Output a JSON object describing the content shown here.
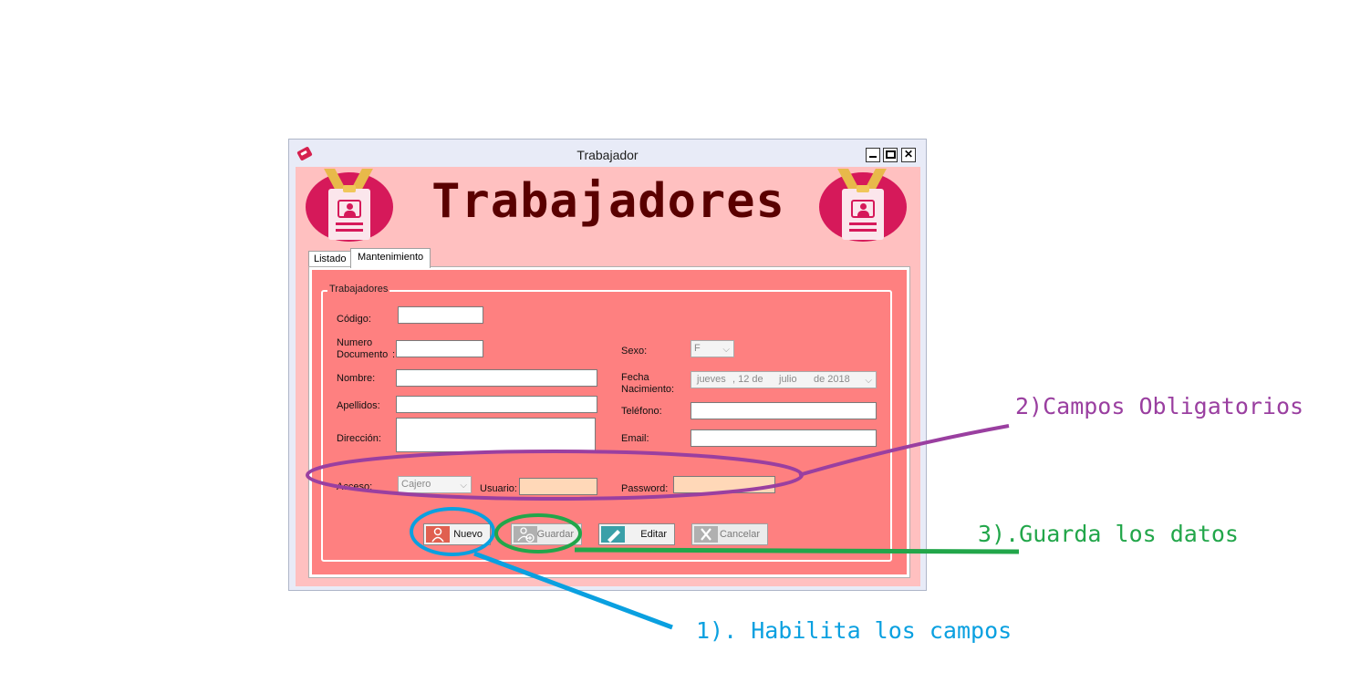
{
  "window": {
    "title": "Trabajador"
  },
  "header": {
    "brand": "Trabajadores"
  },
  "tabs": [
    {
      "label": "Listado"
    },
    {
      "label": "Mantenimiento"
    }
  ],
  "group": {
    "title": "Trabajadores"
  },
  "fields": {
    "codigo": {
      "label": "Código:",
      "value": ""
    },
    "documento": {
      "label_line1": "Numero",
      "label_line2": "Documento",
      "colon": ":",
      "value": ""
    },
    "nombre": {
      "label": "Nombre:",
      "value": ""
    },
    "apellidos": {
      "label": "Apellidos:",
      "value": ""
    },
    "direccion": {
      "label": "Dirección:",
      "value": ""
    },
    "sexo": {
      "label": "Sexo:",
      "value": "F"
    },
    "fecha": {
      "label_line1": "Fecha",
      "label_line2": "Nacimiento:",
      "day_name": "jueves",
      "day": ", 12 de",
      "month": "julio",
      "year": "de 2018"
    },
    "telefono": {
      "label": "Teléfono:",
      "value": ""
    },
    "email": {
      "label": "Email:",
      "value": ""
    },
    "acceso": {
      "label": "Acceso:",
      "value": "Cajero"
    },
    "usuario": {
      "label": "Usuario:",
      "value": ""
    },
    "password": {
      "label": "Password:",
      "value": ""
    }
  },
  "buttons": {
    "nuevo": "Nuevo",
    "guardar": "Guardar",
    "editar": "Editar",
    "cancelar": "Cancelar"
  },
  "annotations": {
    "one": {
      "text": "1). Habilita los campos",
      "color": "#0aa0e0"
    },
    "two": {
      "text": "2)Campos Obligatorios",
      "color": "#9a3fa0"
    },
    "three": {
      "text": "3).Guarda los datos",
      "color": "#22a64a"
    }
  },
  "colors": {
    "form_bg": "#fe8080",
    "header_bg": "#ffc0c0",
    "brand_text": "#5a0000",
    "badge": "#d6195a"
  }
}
